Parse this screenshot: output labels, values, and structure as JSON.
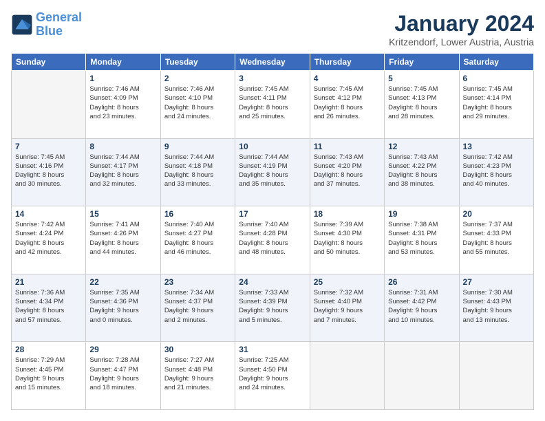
{
  "header": {
    "logo_line1": "General",
    "logo_line2": "Blue",
    "month_year": "January 2024",
    "location": "Kritzendorf, Lower Austria, Austria"
  },
  "days_of_week": [
    "Sunday",
    "Monday",
    "Tuesday",
    "Wednesday",
    "Thursday",
    "Friday",
    "Saturday"
  ],
  "weeks": [
    [
      {
        "day": "",
        "info": ""
      },
      {
        "day": "1",
        "info": "Sunrise: 7:46 AM\nSunset: 4:09 PM\nDaylight: 8 hours\nand 23 minutes."
      },
      {
        "day": "2",
        "info": "Sunrise: 7:46 AM\nSunset: 4:10 PM\nDaylight: 8 hours\nand 24 minutes."
      },
      {
        "day": "3",
        "info": "Sunrise: 7:45 AM\nSunset: 4:11 PM\nDaylight: 8 hours\nand 25 minutes."
      },
      {
        "day": "4",
        "info": "Sunrise: 7:45 AM\nSunset: 4:12 PM\nDaylight: 8 hours\nand 26 minutes."
      },
      {
        "day": "5",
        "info": "Sunrise: 7:45 AM\nSunset: 4:13 PM\nDaylight: 8 hours\nand 28 minutes."
      },
      {
        "day": "6",
        "info": "Sunrise: 7:45 AM\nSunset: 4:14 PM\nDaylight: 8 hours\nand 29 minutes."
      }
    ],
    [
      {
        "day": "7",
        "info": "Sunrise: 7:45 AM\nSunset: 4:16 PM\nDaylight: 8 hours\nand 30 minutes."
      },
      {
        "day": "8",
        "info": "Sunrise: 7:44 AM\nSunset: 4:17 PM\nDaylight: 8 hours\nand 32 minutes."
      },
      {
        "day": "9",
        "info": "Sunrise: 7:44 AM\nSunset: 4:18 PM\nDaylight: 8 hours\nand 33 minutes."
      },
      {
        "day": "10",
        "info": "Sunrise: 7:44 AM\nSunset: 4:19 PM\nDaylight: 8 hours\nand 35 minutes."
      },
      {
        "day": "11",
        "info": "Sunrise: 7:43 AM\nSunset: 4:20 PM\nDaylight: 8 hours\nand 37 minutes."
      },
      {
        "day": "12",
        "info": "Sunrise: 7:43 AM\nSunset: 4:22 PM\nDaylight: 8 hours\nand 38 minutes."
      },
      {
        "day": "13",
        "info": "Sunrise: 7:42 AM\nSunset: 4:23 PM\nDaylight: 8 hours\nand 40 minutes."
      }
    ],
    [
      {
        "day": "14",
        "info": "Sunrise: 7:42 AM\nSunset: 4:24 PM\nDaylight: 8 hours\nand 42 minutes."
      },
      {
        "day": "15",
        "info": "Sunrise: 7:41 AM\nSunset: 4:26 PM\nDaylight: 8 hours\nand 44 minutes."
      },
      {
        "day": "16",
        "info": "Sunrise: 7:40 AM\nSunset: 4:27 PM\nDaylight: 8 hours\nand 46 minutes."
      },
      {
        "day": "17",
        "info": "Sunrise: 7:40 AM\nSunset: 4:28 PM\nDaylight: 8 hours\nand 48 minutes."
      },
      {
        "day": "18",
        "info": "Sunrise: 7:39 AM\nSunset: 4:30 PM\nDaylight: 8 hours\nand 50 minutes."
      },
      {
        "day": "19",
        "info": "Sunrise: 7:38 AM\nSunset: 4:31 PM\nDaylight: 8 hours\nand 53 minutes."
      },
      {
        "day": "20",
        "info": "Sunrise: 7:37 AM\nSunset: 4:33 PM\nDaylight: 8 hours\nand 55 minutes."
      }
    ],
    [
      {
        "day": "21",
        "info": "Sunrise: 7:36 AM\nSunset: 4:34 PM\nDaylight: 8 hours\nand 57 minutes."
      },
      {
        "day": "22",
        "info": "Sunrise: 7:35 AM\nSunset: 4:36 PM\nDaylight: 9 hours\nand 0 minutes."
      },
      {
        "day": "23",
        "info": "Sunrise: 7:34 AM\nSunset: 4:37 PM\nDaylight: 9 hours\nand 2 minutes."
      },
      {
        "day": "24",
        "info": "Sunrise: 7:33 AM\nSunset: 4:39 PM\nDaylight: 9 hours\nand 5 minutes."
      },
      {
        "day": "25",
        "info": "Sunrise: 7:32 AM\nSunset: 4:40 PM\nDaylight: 9 hours\nand 7 minutes."
      },
      {
        "day": "26",
        "info": "Sunrise: 7:31 AM\nSunset: 4:42 PM\nDaylight: 9 hours\nand 10 minutes."
      },
      {
        "day": "27",
        "info": "Sunrise: 7:30 AM\nSunset: 4:43 PM\nDaylight: 9 hours\nand 13 minutes."
      }
    ],
    [
      {
        "day": "28",
        "info": "Sunrise: 7:29 AM\nSunset: 4:45 PM\nDaylight: 9 hours\nand 15 minutes."
      },
      {
        "day": "29",
        "info": "Sunrise: 7:28 AM\nSunset: 4:47 PM\nDaylight: 9 hours\nand 18 minutes."
      },
      {
        "day": "30",
        "info": "Sunrise: 7:27 AM\nSunset: 4:48 PM\nDaylight: 9 hours\nand 21 minutes."
      },
      {
        "day": "31",
        "info": "Sunrise: 7:25 AM\nSunset: 4:50 PM\nDaylight: 9 hours\nand 24 minutes."
      },
      {
        "day": "",
        "info": ""
      },
      {
        "day": "",
        "info": ""
      },
      {
        "day": "",
        "info": ""
      }
    ]
  ]
}
